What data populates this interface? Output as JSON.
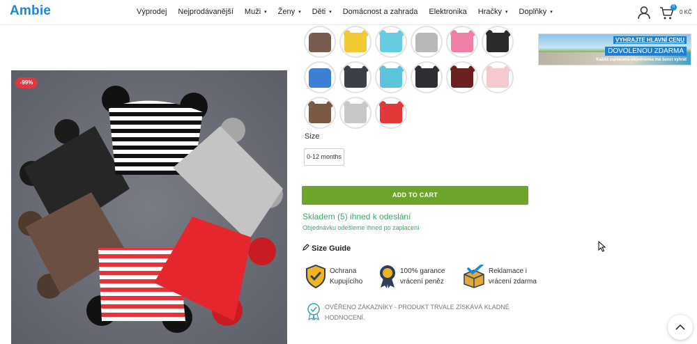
{
  "header": {
    "logo": "Ambie",
    "logo_small": "",
    "nav": [
      {
        "label": "Výprodej",
        "has_dropdown": false
      },
      {
        "label": "Nejprodávanější",
        "has_dropdown": false
      },
      {
        "label": "Muži",
        "has_dropdown": true
      },
      {
        "label": "Ženy",
        "has_dropdown": true
      },
      {
        "label": "Děti",
        "has_dropdown": true
      },
      {
        "label": "Domácnost a zahrada",
        "has_dropdown": false
      },
      {
        "label": "Elektronika",
        "has_dropdown": false
      },
      {
        "label": "Hračky",
        "has_dropdown": true
      },
      {
        "label": "Doplňky",
        "has_dropdown": true
      }
    ],
    "cart_count": "0",
    "cart_total": "0 KČ",
    "caret": "▾"
  },
  "product": {
    "discount": "-99%",
    "color_swatches": [
      {
        "color": "#7a5c4f",
        "ears": false
      },
      {
        "color": "#f2c933",
        "ears": true
      },
      {
        "color": "#66cde0",
        "ears": true
      },
      {
        "color": "#b8b8b8",
        "ears": false
      },
      {
        "color": "#f07fa8",
        "ears": true
      },
      {
        "color": "#2b2b2b",
        "ears": true
      },
      {
        "color": "#3d7fd4",
        "ears": false
      },
      {
        "color": "#3b3f49",
        "ears": true
      },
      {
        "color": "#5bc6db",
        "ears": true
      },
      {
        "color": "#2c2e33",
        "ears": true
      },
      {
        "color": "#6b1f1f",
        "ears": true
      },
      {
        "color": "#f4c9cf",
        "ears": true
      },
      {
        "color": "#7a5a45",
        "ears": true
      },
      {
        "color": "#c8c8c8",
        "ears": true
      },
      {
        "color": "#e23838",
        "ears": true
      }
    ],
    "size_label": "Size",
    "size_value": "0-12 months",
    "add_to_cart": "ADD TO CART",
    "stock": "Skladem (5) ihned k odeslání",
    "shipping": "Objednávku odešleme ihned po zaplacení",
    "size_guide": "Size Guide",
    "trust": [
      {
        "line1": "Ochrana",
        "line2": "Kupujícího",
        "icon": "shield-check-icon"
      },
      {
        "line1": "100% garance",
        "line2": "vrácení peněz",
        "icon": "medal-icon"
      },
      {
        "line1": "Reklamace i",
        "line2": "vrácení zdarma",
        "icon": "box-check-icon"
      }
    ],
    "verified_line1": "OVĚŘENO ZÁKAZNÍKY - PRODUKT TRVALE ZÍSKÁVÁ KLADNÉ",
    "verified_line2": "HODNOCENÍ."
  },
  "banner": {
    "line1": "VYHRAJTE HLAVNÍ CENU",
    "line2": "DOVOLENOU ZDARMA",
    "line3": "Každá zaplacená objednávka má šanci vyhrát"
  },
  "colors": {
    "brand": "#1a8ad4",
    "add_to_cart": "#6da52a",
    "stock": "#3aa86b",
    "discount": "#e0383e"
  }
}
